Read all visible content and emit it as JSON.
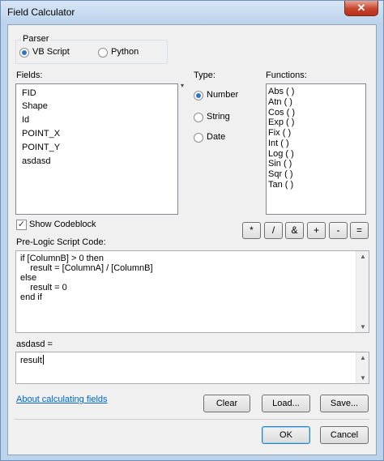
{
  "window": {
    "title": "Field Calculator",
    "close_glyph": "✕"
  },
  "parser": {
    "label": "Parser",
    "options": [
      {
        "label": "VB Script",
        "selected": true
      },
      {
        "label": "Python",
        "selected": false
      }
    ]
  },
  "fields": {
    "label": "Fields:",
    "items": [
      "FID",
      "Shape",
      "Id",
      "POINT_X",
      "POINT_Y",
      "asdasd"
    ]
  },
  "type": {
    "label": "Type:",
    "options": [
      {
        "label": "Number",
        "selected": true
      },
      {
        "label": "String",
        "selected": false
      },
      {
        "label": "Date",
        "selected": false
      }
    ]
  },
  "functions": {
    "label": "Functions:",
    "items": [
      "Abs ( )",
      "Atn ( )",
      "Cos ( )",
      "Exp ( )",
      "Fix ( )",
      "Int ( )",
      "Log ( )",
      "Sin ( )",
      "Sqr ( )",
      "Tan ( )"
    ]
  },
  "codeblock": {
    "label": "Show Codeblock",
    "checked": true
  },
  "operators": [
    "*",
    "/",
    "&",
    "+",
    "-",
    "="
  ],
  "prelogic": {
    "label": "Pre-Logic Script Code:",
    "lines": [
      "if [ColumnB] > 0 then",
      "    result = [ColumnA] / [ColumnB]",
      "else",
      "    result = 0",
      "end if"
    ]
  },
  "expression": {
    "label": "asdasd =",
    "value": "result"
  },
  "help_link": "About calculating fields",
  "buttons": {
    "clear": "Clear",
    "load": "Load...",
    "save": "Save...",
    "ok": "OK",
    "cancel": "Cancel"
  }
}
